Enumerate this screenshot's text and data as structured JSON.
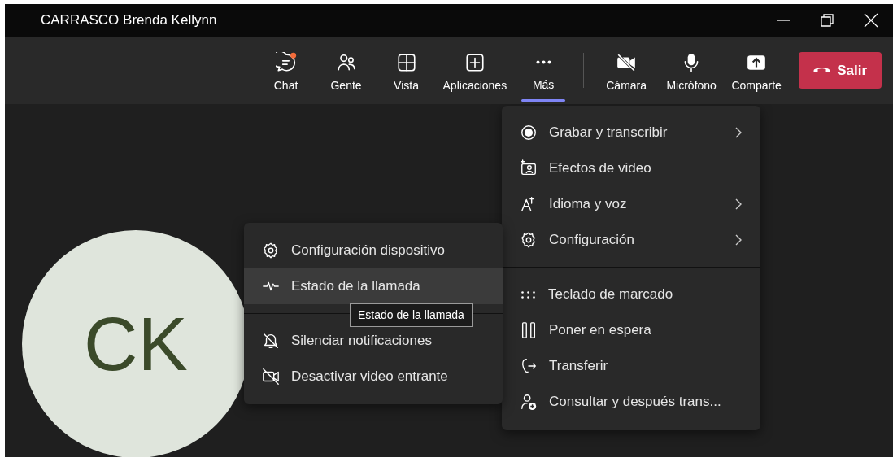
{
  "window": {
    "title": "CARRASCO Brenda Kellynn"
  },
  "toolbar": {
    "tabs": [
      {
        "label": "Chat",
        "selected": false,
        "badge": true
      },
      {
        "label": "Gente",
        "selected": false,
        "badge": false
      },
      {
        "label": "Vista",
        "selected": false,
        "badge": false
      },
      {
        "label": "Aplicaciones",
        "selected": false,
        "badge": false
      },
      {
        "label": "Más",
        "selected": true,
        "badge": false
      }
    ],
    "devices": [
      {
        "label": "Cámara",
        "on": false
      },
      {
        "label": "Micrófono",
        "on": true
      },
      {
        "label": "Comparte"
      }
    ],
    "leave_button": "Salir"
  },
  "avatar": {
    "initials": "CK"
  },
  "more_menu": {
    "sections": [
      [
        {
          "label": "Grabar y transcribir",
          "submenu": true
        },
        {
          "label": "Efectos de video",
          "submenu": false
        },
        {
          "label": "Idioma y voz",
          "submenu": true
        },
        {
          "label": "Configuración",
          "submenu": true
        }
      ],
      [
        {
          "label": "Teclado de marcado",
          "submenu": false
        },
        {
          "label": "Poner en espera",
          "submenu": false
        },
        {
          "label": "Transferir",
          "submenu": false
        },
        {
          "label": "Consultar y después trans...",
          "submenu": false
        }
      ]
    ]
  },
  "device_menu": {
    "sections": [
      [
        {
          "label": "Configuración dispositivo",
          "highlighted": false
        },
        {
          "label": "Estado de la llamada",
          "highlighted": true
        }
      ],
      [
        {
          "label": "Silenciar notificaciones",
          "highlighted": false
        },
        {
          "label": "Desactivar video entrante",
          "highlighted": false
        }
      ]
    ]
  },
  "tooltip": {
    "text": "Estado de la llamada"
  }
}
